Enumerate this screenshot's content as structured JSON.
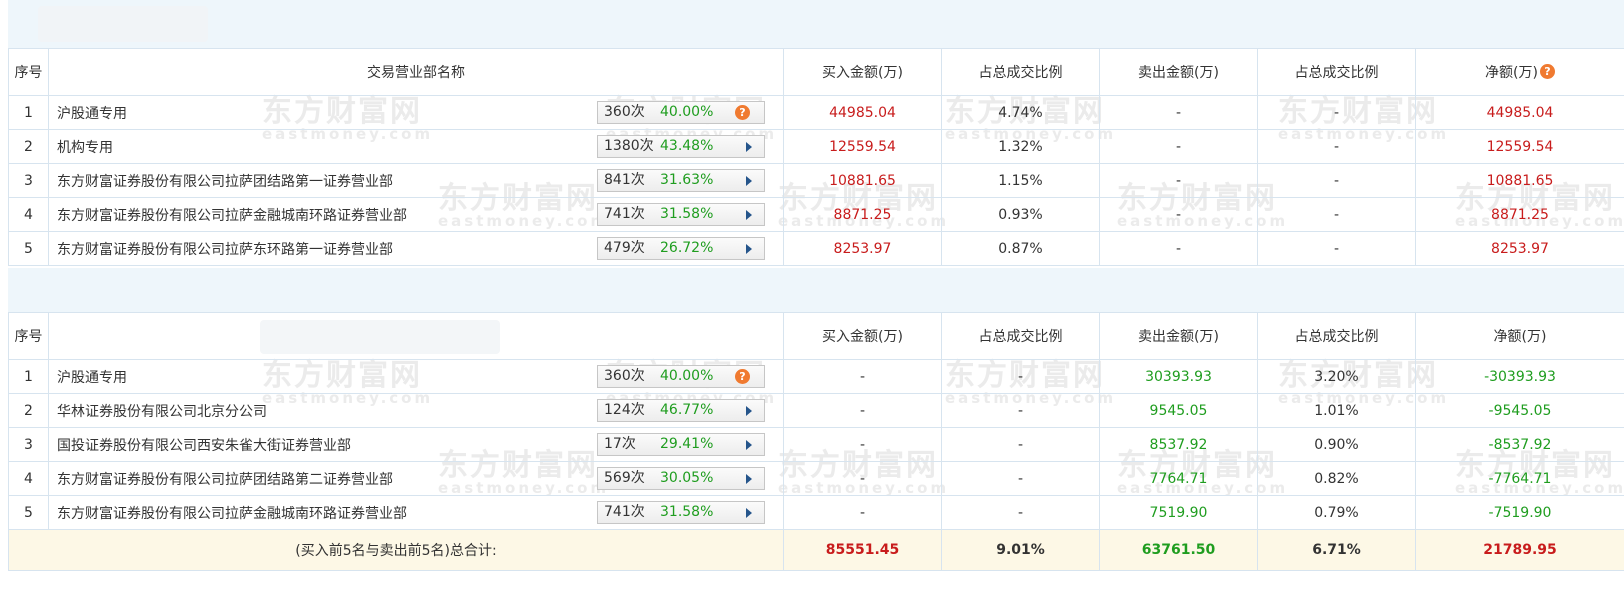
{
  "watermark": {
    "cn": "东方财富网",
    "en": "eastmoney.com"
  },
  "columns": [
    "序号",
    "交易营业部名称",
    "买入金额(万)",
    "占总成交比例",
    "卖出金额(万)",
    "占总成交比例",
    "净额(万)"
  ],
  "buy_rows": [
    {
      "no": "1",
      "name": "沪股通专用",
      "count": "360次",
      "pct": "40.00%",
      "icon": "question-icon",
      "buy": "44985.04",
      "buy_ratio": "4.74%",
      "sell": "-",
      "sell_ratio": "-",
      "net": "44985.04"
    },
    {
      "no": "2",
      "name": "机构专用",
      "count": "1380次",
      "pct": "43.48%",
      "icon": "arrow-right-icon",
      "buy": "12559.54",
      "buy_ratio": "1.32%",
      "sell": "-",
      "sell_ratio": "-",
      "net": "12559.54"
    },
    {
      "no": "3",
      "name": "东方财富证券股份有限公司拉萨团结路第一证券营业部",
      "count": "841次",
      "pct": "31.63%",
      "icon": "arrow-right-icon",
      "buy": "10881.65",
      "buy_ratio": "1.15%",
      "sell": "-",
      "sell_ratio": "-",
      "net": "10881.65"
    },
    {
      "no": "4",
      "name": "东方财富证券股份有限公司拉萨金融城南环路证券营业部",
      "count": "741次",
      "pct": "31.58%",
      "icon": "arrow-right-icon",
      "buy": "8871.25",
      "buy_ratio": "0.93%",
      "sell": "-",
      "sell_ratio": "-",
      "net": "8871.25"
    },
    {
      "no": "5",
      "name": "东方财富证券股份有限公司拉萨东环路第一证券营业部",
      "count": "479次",
      "pct": "26.72%",
      "icon": "arrow-right-icon",
      "buy": "8253.97",
      "buy_ratio": "0.87%",
      "sell": "-",
      "sell_ratio": "-",
      "net": "8253.97"
    }
  ],
  "sell_rows": [
    {
      "no": "1",
      "name": "沪股通专用",
      "count": "360次",
      "pct": "40.00%",
      "icon": "question-icon",
      "buy": "-",
      "buy_ratio": "-",
      "sell": "30393.93",
      "sell_ratio": "3.20%",
      "net": "-30393.93"
    },
    {
      "no": "2",
      "name": "华林证券股份有限公司北京分公司",
      "count": "124次",
      "pct": "46.77%",
      "icon": "arrow-right-icon",
      "buy": "-",
      "buy_ratio": "-",
      "sell": "9545.05",
      "sell_ratio": "1.01%",
      "net": "-9545.05"
    },
    {
      "no": "3",
      "name": "国投证券股份有限公司西安朱雀大街证券营业部",
      "count": "17次",
      "pct": "29.41%",
      "icon": "arrow-right-icon",
      "buy": "-",
      "buy_ratio": "-",
      "sell": "8537.92",
      "sell_ratio": "0.90%",
      "net": "-8537.92"
    },
    {
      "no": "4",
      "name": "东方财富证券股份有限公司拉萨团结路第二证券营业部",
      "count": "569次",
      "pct": "30.05%",
      "icon": "arrow-right-icon",
      "buy": "-",
      "buy_ratio": "-",
      "sell": "7764.71",
      "sell_ratio": "0.82%",
      "net": "-7764.71"
    },
    {
      "no": "5",
      "name": "东方财富证券股份有限公司拉萨金融城南环路证券营业部",
      "count": "741次",
      "pct": "31.58%",
      "icon": "arrow-right-icon",
      "buy": "-",
      "buy_ratio": "-",
      "sell": "7519.90",
      "sell_ratio": "0.79%",
      "net": "-7519.90"
    }
  ],
  "total": {
    "label": "(买入前5名与卖出前5名)总合计:",
    "buy": "85551.45",
    "buy_ratio": "9.01%",
    "sell": "63761.50",
    "sell_ratio": "6.71%",
    "net": "21789.95"
  },
  "colors": {
    "buy": "#c81c1c",
    "sell": "#1f9d1f",
    "border": "#d7e4ef",
    "band": "#eef6fb",
    "total_bg": "#fdf8e6"
  },
  "help_icon_glyph": "?"
}
